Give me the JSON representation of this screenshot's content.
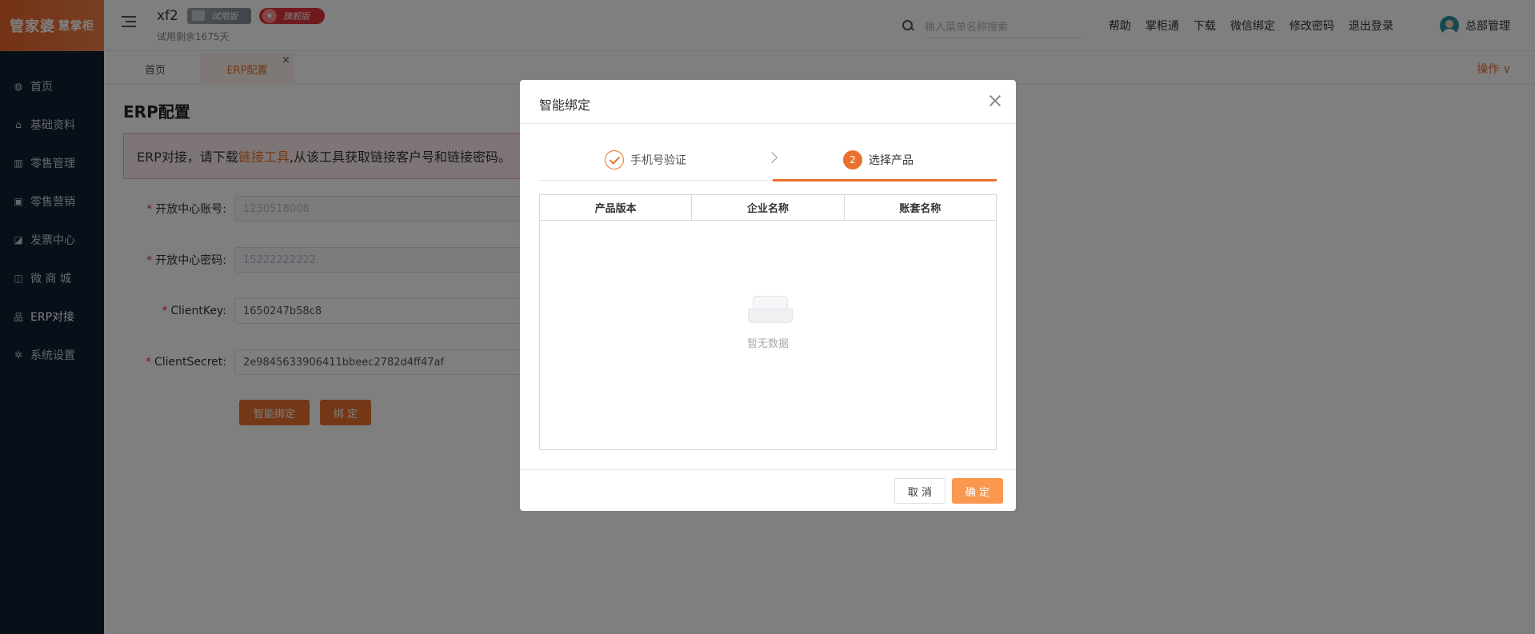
{
  "sidebar": {
    "logo_main": "管家婆",
    "logo_sub": "慧掌柜",
    "items": [
      {
        "label": "首页",
        "icon": "globe-icon"
      },
      {
        "label": "基础资料",
        "icon": "home-icon"
      },
      {
        "label": "零售管理",
        "icon": "bar-chart-icon"
      },
      {
        "label": "零售营销",
        "icon": "gift-icon"
      },
      {
        "label": "发票中心",
        "icon": "line-chart-icon"
      },
      {
        "label": "微 商 城",
        "icon": "bag-icon"
      },
      {
        "label": "ERP对接",
        "icon": "org-chart-icon"
      },
      {
        "label": "系统设置",
        "icon": "gear-icon"
      }
    ]
  },
  "header": {
    "shop_name": "xf2",
    "badge_trial": "试用版",
    "badge_flag": "旗舰版",
    "trial_remaining": "试用剩余1675天",
    "search_placeholder": "输入菜单名称搜索",
    "links": [
      "帮助",
      "掌柜通",
      "下载",
      "微信绑定",
      "修改密码",
      "退出登录"
    ],
    "user_name": "总部管理"
  },
  "tabs": {
    "items": [
      "首页",
      "ERP配置"
    ],
    "close": "×",
    "ops": "操作 ∨"
  },
  "main": {
    "title": "ERP配置",
    "notice_prefix": "ERP对接，请下载",
    "notice_link": "链接工具",
    "notice_suffix": ",从该工具获取链接客户号和链接密码。",
    "fields": [
      {
        "label": "开放中心账号",
        "value": "1230518008"
      },
      {
        "label": "开放中心密码",
        "value": "15222222222"
      },
      {
        "label": "ClientKey",
        "value": "1650247b58c8"
      },
      {
        "label": "ClientSecret",
        "value": "2e9845633906411bbeec2782d4ff47af"
      }
    ],
    "btn_smart_bind": "智能绑定",
    "btn_bind": "绑 定"
  },
  "dialog": {
    "title": "智能绑定",
    "step1": "手机号验证",
    "step2_num": "2",
    "step2": "选择产品",
    "columns": [
      "产品版本",
      "企业名称",
      "账套名称"
    ],
    "empty_text": "暂无数据",
    "cancel": "取 消",
    "confirm": "确 定"
  },
  "colors": {
    "accent": "#e8712e",
    "sidebar_bg": "#0f1f33"
  }
}
